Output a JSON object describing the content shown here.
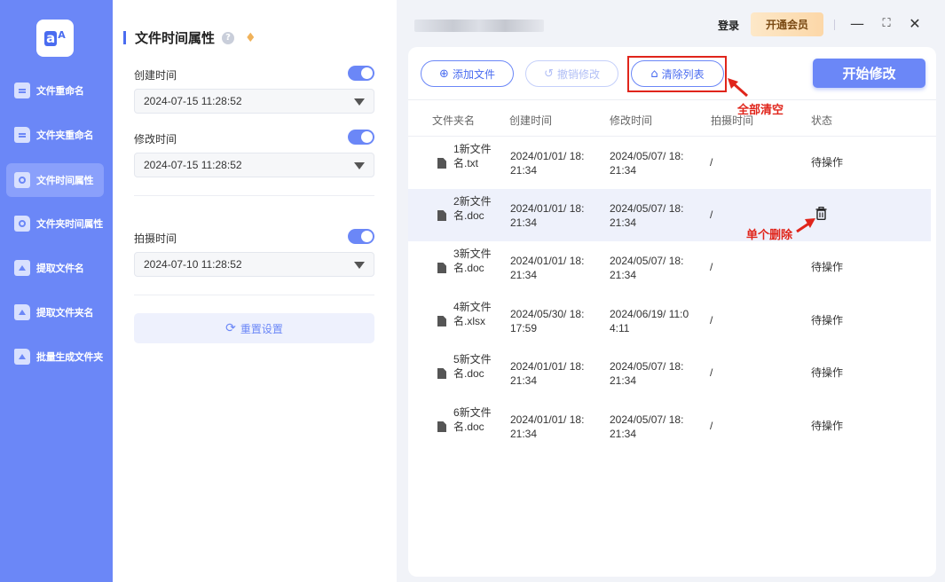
{
  "sidebar": {
    "items": [
      {
        "label": "文件重命名",
        "icon": "document-icon"
      },
      {
        "label": "文件夹重命名",
        "icon": "folder-icon"
      },
      {
        "label": "文件时间属性",
        "icon": "clock-icon"
      },
      {
        "label": "文件夹时间属性",
        "icon": "folder-clock-icon"
      },
      {
        "label": "提取文件名",
        "icon": "extract-icon"
      },
      {
        "label": "提取文件夹名",
        "icon": "folder-extract-icon"
      },
      {
        "label": "批量生成文件夹",
        "icon": "folder-add-icon"
      }
    ],
    "active_index": 2
  },
  "panel": {
    "title": "文件时间属性",
    "create": {
      "label": "创建时间",
      "value": "2024-07-15 11:28:52",
      "enabled": true
    },
    "modify": {
      "label": "修改时间",
      "value": "2024-07-15 11:28:52",
      "enabled": true
    },
    "shot": {
      "label": "拍摄时间",
      "value": "2024-07-10 11:28:52",
      "enabled": true
    },
    "reset_label": "重置设置"
  },
  "titlebar": {
    "login": "登录",
    "vip": "开通会员"
  },
  "toolbar": {
    "add_label": "添加文件",
    "undo_label": "撤销修改",
    "clear_label": "清除列表",
    "start_label": "开始修改"
  },
  "table": {
    "headers": [
      "文件夹名",
      "创建时间",
      "修改时间",
      "拍摄时间",
      "状态"
    ],
    "rows": [
      {
        "name": "1新文件名.txt",
        "created": "2024/01/01/ 18:21:34",
        "modified": "2024/05/07/ 18:21:34",
        "shot": "/",
        "status": "待操作"
      },
      {
        "name": "2新文件名.doc",
        "created": "2024/01/01/ 18:21:34",
        "modified": "2024/05/07/ 18:21:34",
        "shot": "/",
        "status": ""
      },
      {
        "name": "3新文件名.doc",
        "created": "2024/01/01/ 18:21:34",
        "modified": "2024/05/07/ 18:21:34",
        "shot": "/",
        "status": "待操作"
      },
      {
        "name": "4新文件名.xlsx",
        "created": "2024/05/30/ 18:17:59",
        "modified": "2024/06/19/ 11:04:11",
        "shot": "/",
        "status": "待操作"
      },
      {
        "name": "5新文件名.doc",
        "created": "2024/01/01/ 18:21:34",
        "modified": "2024/05/07/ 18:21:34",
        "shot": "/",
        "status": "待操作"
      },
      {
        "name": "6新文件名.doc",
        "created": "2024/01/01/ 18:21:34",
        "modified": "2024/05/07/ 18:21:34",
        "shot": "/",
        "status": "待操作"
      }
    ]
  },
  "annotations": {
    "clear_all": "全部清空",
    "single_delete": "单个删除"
  },
  "colors": {
    "accent": "#6b87f7",
    "annotation": "#e0251b"
  }
}
